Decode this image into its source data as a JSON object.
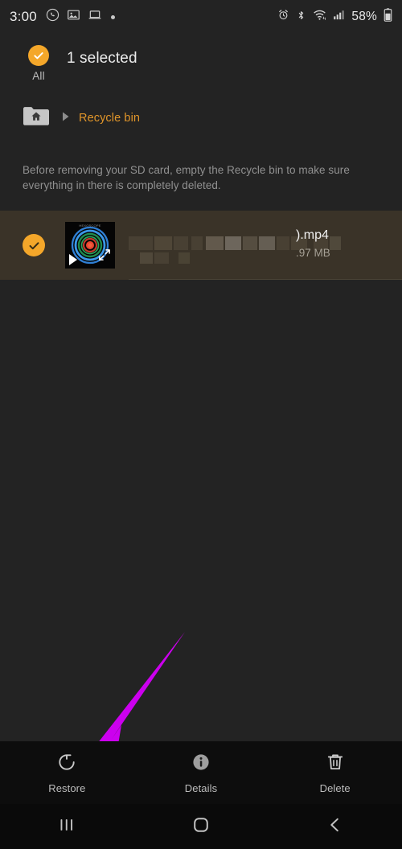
{
  "status_bar": {
    "time": "3:00",
    "battery_percent": "58%",
    "left_icons": [
      "whatsapp-icon",
      "image-icon",
      "laptop-icon",
      "more-notifications-dot"
    ],
    "right_icons": [
      "alarm-icon",
      "bluetooth-icon",
      "wifi-icon",
      "signal-icon",
      "battery-icon"
    ]
  },
  "selection_header": {
    "all_label": "All",
    "all_checked": true,
    "count_text": "1 selected"
  },
  "breadcrumb": {
    "root_icon": "folder-home-icon",
    "separator_icon": "chevron-right-icon",
    "current": "Recycle bin"
  },
  "info_note": {
    "text": "Before removing your SD card, empty the Recycle bin to make sure everything in there is completely deleted."
  },
  "file_row": {
    "checked": true,
    "thumbnail": {
      "type": "video-thumbnail",
      "overlay_title": "HEXOSCOPE",
      "play_icon": "play-icon",
      "expand_icon": "expand-arrows-icon"
    },
    "name": ").mp4",
    "size": ".97 MB",
    "name_redacted": true
  },
  "annotation": {
    "type": "arrow",
    "color": "#cc00ee",
    "points_to": "restore-button"
  },
  "action_bar": {
    "items": [
      {
        "label": "Restore",
        "icon": "restore-icon"
      },
      {
        "label": "Details",
        "icon": "info-icon"
      },
      {
        "label": "Delete",
        "icon": "trash-icon"
      }
    ]
  },
  "nav_bar": {
    "items": [
      {
        "name": "recents-button",
        "icon": "recents-icon"
      },
      {
        "name": "home-button",
        "icon": "home-icon"
      },
      {
        "name": "back-button",
        "icon": "back-chevron-icon"
      }
    ]
  },
  "colors": {
    "background": "#232323",
    "accent": "#f4a72a",
    "breadcrumb_text": "#e0952a",
    "selected_row": "#3a3328",
    "action_bar": "#0d0d0d",
    "nav_bar": "#0a0a0a",
    "annotation": "#cc00ee"
  }
}
